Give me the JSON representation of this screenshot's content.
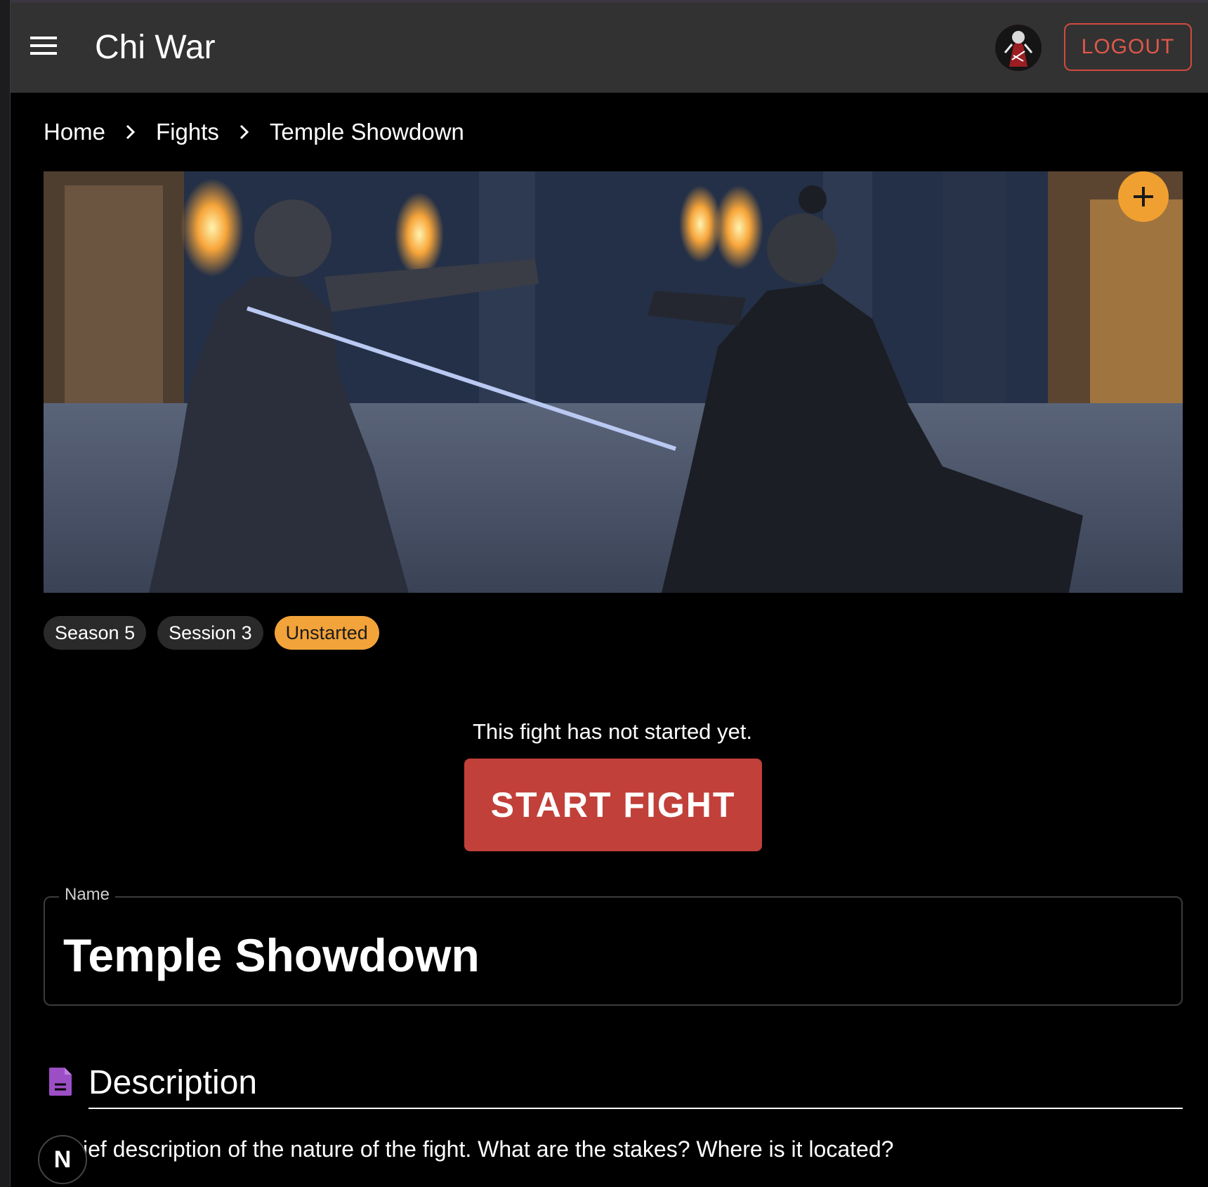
{
  "appbar": {
    "title": "Chi War",
    "logout_label": "LOGOUT"
  },
  "breadcrumb": {
    "items": [
      "Home",
      "Fights",
      "Temple Showdown"
    ]
  },
  "hero": {
    "image_icon": "fight-scene-image",
    "add_icon": "plus-icon"
  },
  "chips": {
    "season": "Season 5",
    "session": "Session 3",
    "status": "Unstarted"
  },
  "fight": {
    "notice": "This fight has not started yet.",
    "start_label": "START FIGHT"
  },
  "name_field": {
    "label": "Name",
    "value": "Temple Showdown"
  },
  "description": {
    "icon": "document-icon",
    "title": "Description",
    "body": "ief description of the nature of the fight. What are the stakes? Where is it located?"
  },
  "dev_badge": {
    "label": "N"
  },
  "colors": {
    "appbar": "#323232",
    "accent_orange": "#f0a030",
    "danger_red": "#c2403a",
    "logout_red": "#e0574a",
    "description_icon": "#9c4fc4"
  }
}
